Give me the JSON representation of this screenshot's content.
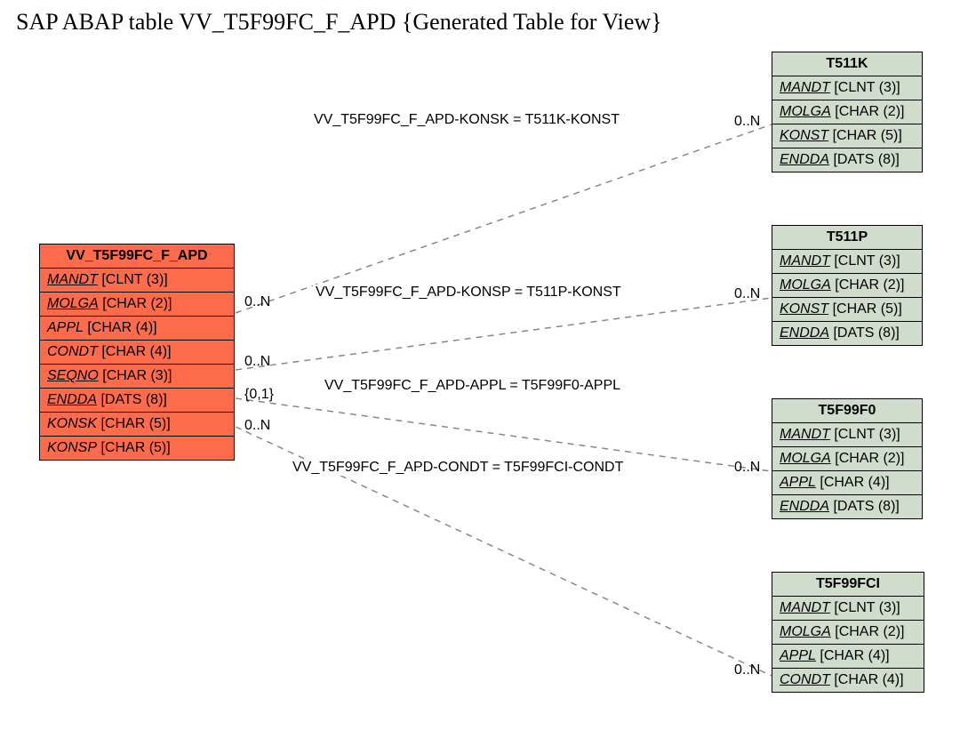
{
  "title": "SAP ABAP table VV_T5F99FC_F_APD {Generated Table for View}",
  "main": {
    "name": "VV_T5F99FC_F_APD",
    "fields": [
      {
        "name": "MANDT",
        "type": "[CLNT (3)]",
        "keyed": true
      },
      {
        "name": "MOLGA",
        "type": "[CHAR (2)]",
        "keyed": true
      },
      {
        "name": "APPL",
        "type": "[CHAR (4)]",
        "keyed": false,
        "italic": true
      },
      {
        "name": "CONDT",
        "type": "[CHAR (4)]",
        "keyed": false,
        "italic": true
      },
      {
        "name": "SEQNO",
        "type": "[CHAR (3)]",
        "keyed": true
      },
      {
        "name": "ENDDA",
        "type": "[DATS (8)]",
        "keyed": true
      },
      {
        "name": "KONSK",
        "type": "[CHAR (5)]",
        "keyed": false,
        "italic": true
      },
      {
        "name": "KONSP",
        "type": "[CHAR (5)]",
        "keyed": false,
        "italic": true
      }
    ]
  },
  "rels": {
    "r1": {
      "label": "VV_T5F99FC_F_APD-KONSK = T511K-KONST",
      "left": "0..N",
      "right": "0..N"
    },
    "r2": {
      "label": "VV_T5F99FC_F_APD-KONSP = T511P-KONST",
      "left": "0..N",
      "right": "0..N"
    },
    "r3": {
      "label": "VV_T5F99FC_F_APD-APPL = T5F99F0-APPL",
      "left": "{0,1}",
      "right": "0..N"
    },
    "r4": {
      "label": "VV_T5F99FC_F_APD-CONDT = T5F99FCI-CONDT",
      "left": "0..N",
      "right": "0..N"
    }
  },
  "t511k": {
    "name": "T511K",
    "fields": [
      {
        "name": "MANDT",
        "type": "[CLNT (3)]",
        "keyed": true,
        "italic": true
      },
      {
        "name": "MOLGA",
        "type": "[CHAR (2)]",
        "keyed": true,
        "italic": true
      },
      {
        "name": "KONST",
        "type": "[CHAR (5)]",
        "keyed": true
      },
      {
        "name": "ENDDA",
        "type": "[DATS (8)]",
        "keyed": true
      }
    ]
  },
  "t511p": {
    "name": "T511P",
    "fields": [
      {
        "name": "MANDT",
        "type": "[CLNT (3)]",
        "keyed": true,
        "italic": true
      },
      {
        "name": "MOLGA",
        "type": "[CHAR (2)]",
        "keyed": true,
        "italic": true
      },
      {
        "name": "KONST",
        "type": "[CHAR (5)]",
        "keyed": true
      },
      {
        "name": "ENDDA",
        "type": "[DATS (8)]",
        "keyed": true
      }
    ]
  },
  "t5f99f0": {
    "name": "T5F99F0",
    "fields": [
      {
        "name": "MANDT",
        "type": "[CLNT (3)]",
        "keyed": true,
        "italic": true
      },
      {
        "name": "MOLGA",
        "type": "[CHAR (2)]",
        "keyed": true,
        "italic": true
      },
      {
        "name": "APPL",
        "type": "[CHAR (4)]",
        "keyed": true,
        "italic": true
      },
      {
        "name": "ENDDA",
        "type": "[DATS (8)]",
        "keyed": true
      }
    ]
  },
  "t5f99fci": {
    "name": "T5F99FCI",
    "fields": [
      {
        "name": "MANDT",
        "type": "[CLNT (3)]",
        "keyed": true,
        "italic": true
      },
      {
        "name": "MOLGA",
        "type": "[CHAR (2)]",
        "keyed": true,
        "italic": true
      },
      {
        "name": "APPL",
        "type": "[CHAR (4)]",
        "keyed": true,
        "italic": true
      },
      {
        "name": "CONDT",
        "type": "[CHAR (4)]",
        "keyed": true
      }
    ]
  }
}
